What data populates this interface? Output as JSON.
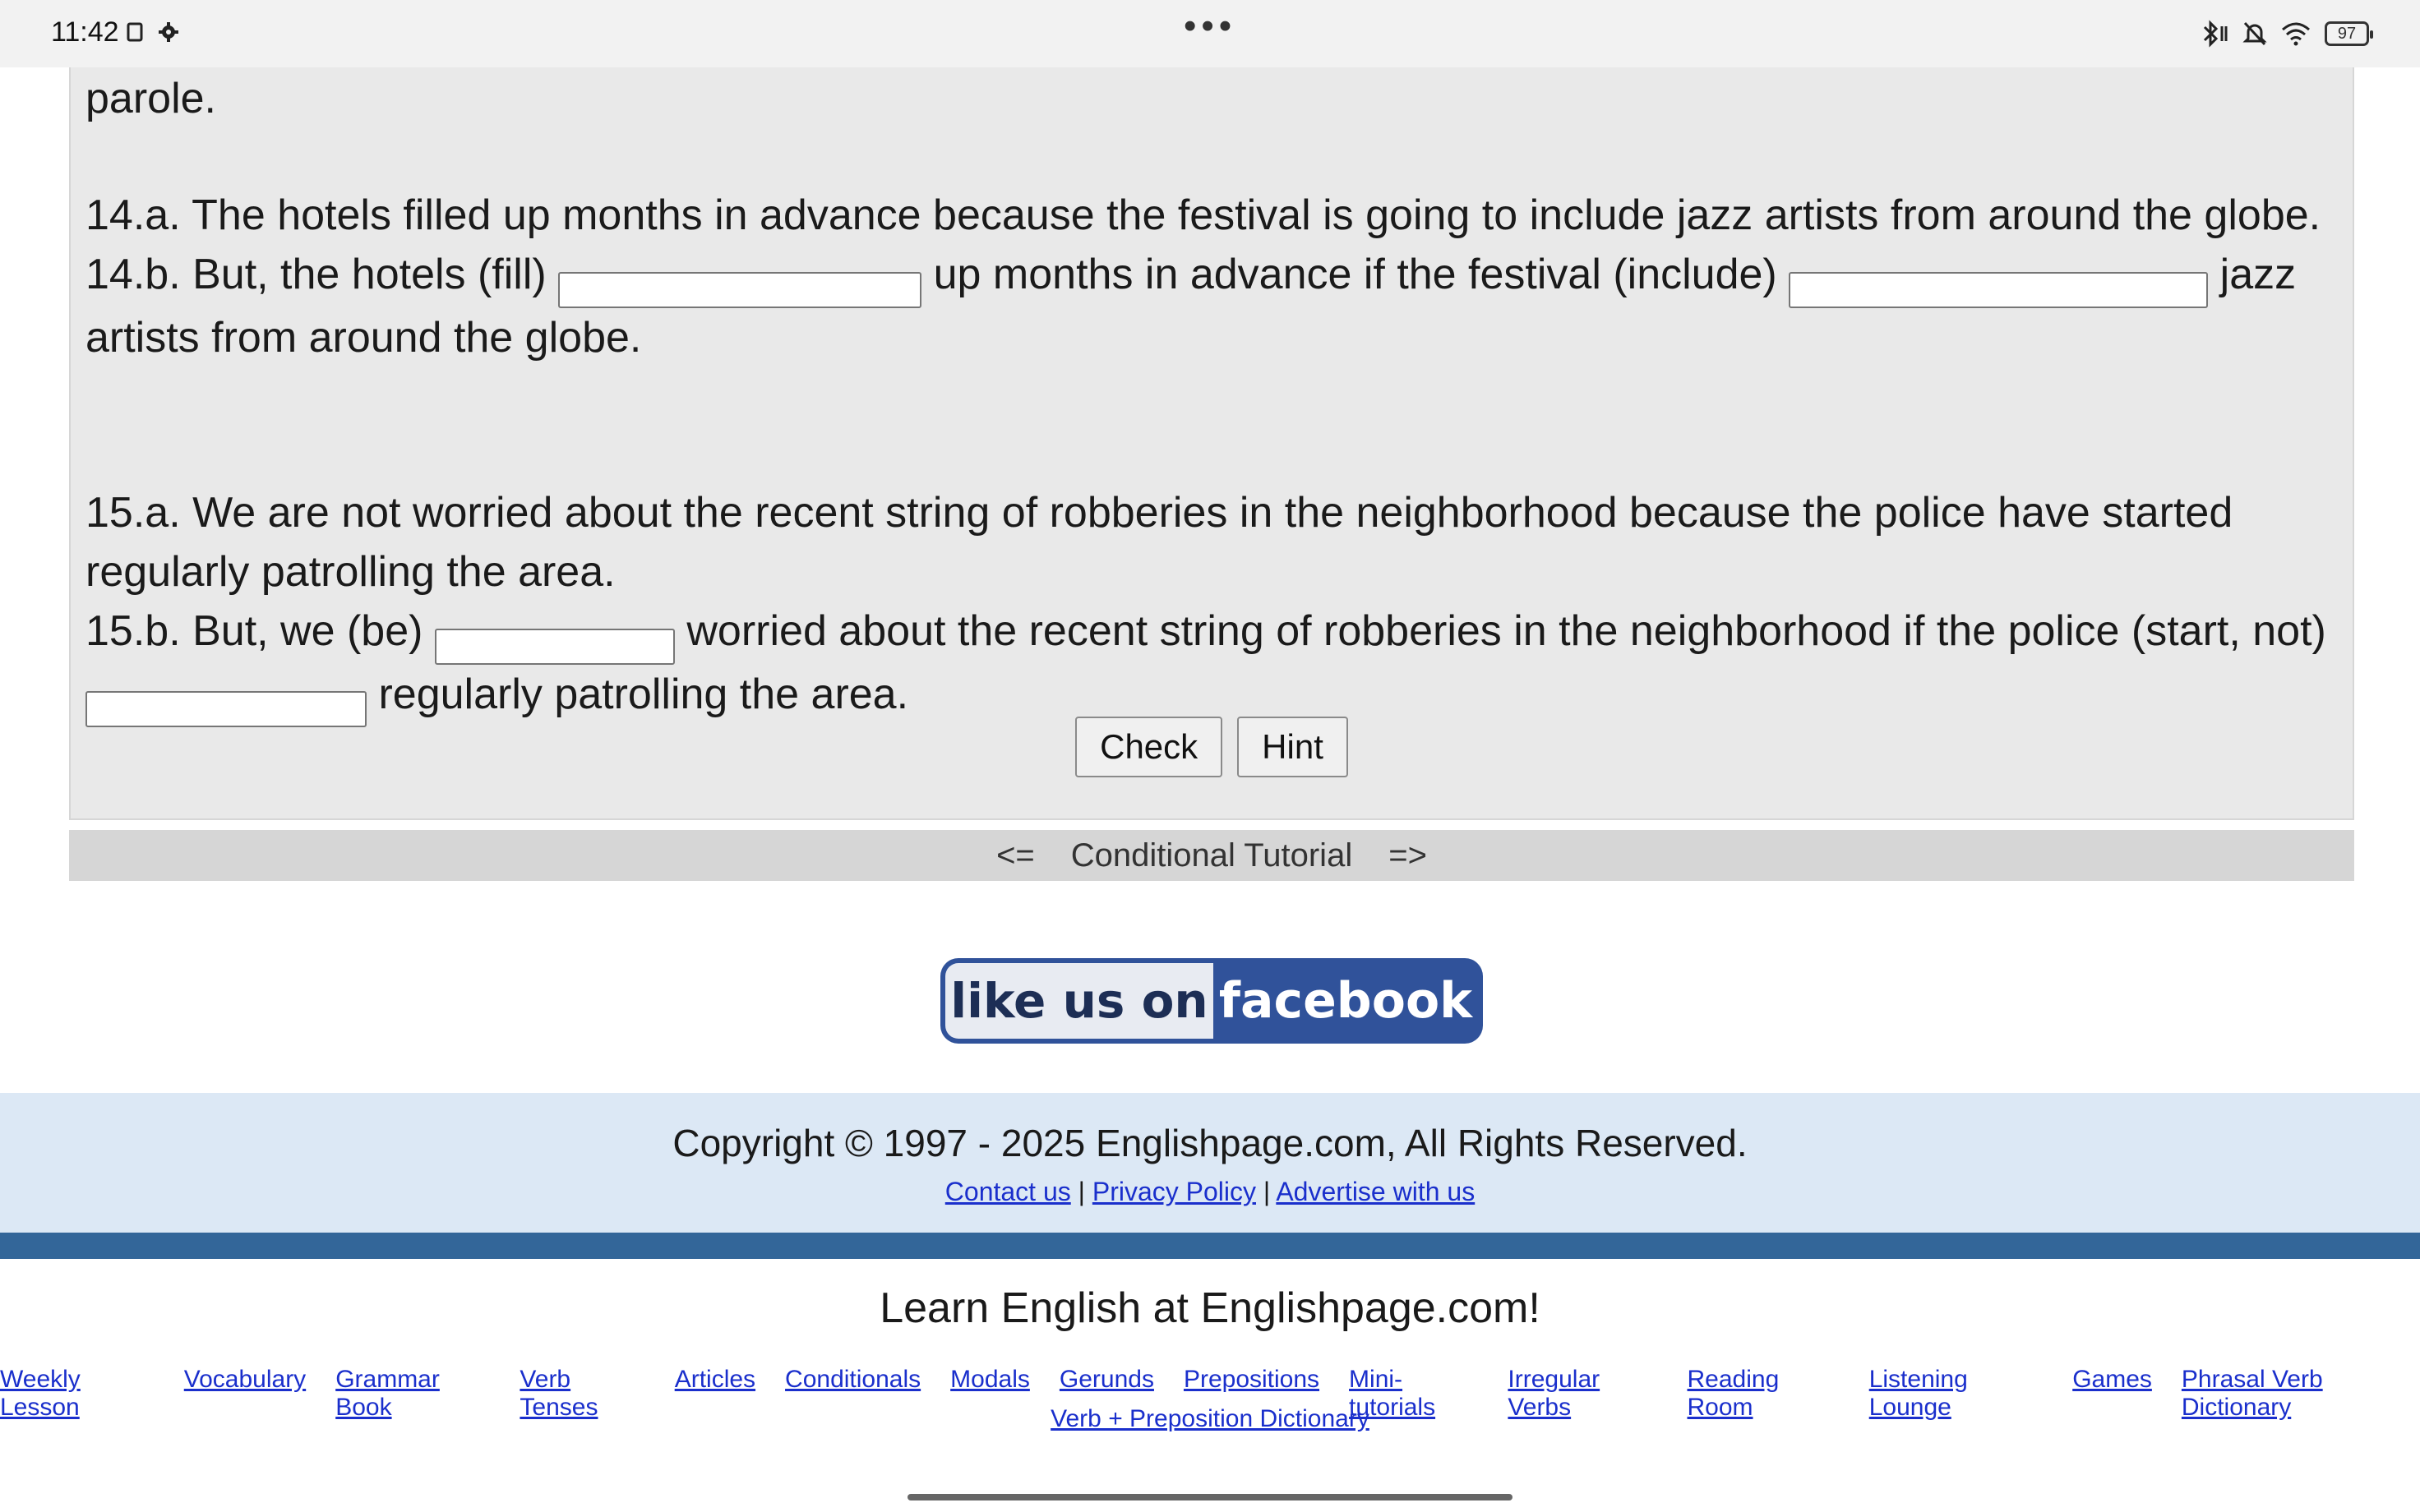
{
  "status_bar": {
    "time": "11:42",
    "left_icons": [
      "tablet-icon",
      "settings-icon"
    ],
    "right_icons": [
      "bluetooth-icon",
      "mute-icon",
      "wifi-icon",
      "battery-icon"
    ],
    "battery_level": "97",
    "menu": "•••"
  },
  "exercise": {
    "carryover": "parole.",
    "q14a": "14.a. The hotels filled up months in advance because the festival is going to include jazz artists from around the globe.",
    "q14b": {
      "part1": "14.b. But, the hotels (fill)",
      "part2": "up months in advance if the festival (include)",
      "part3": "jazz",
      "part4": "artists from around the globe.",
      "blank1_value": "",
      "blank2_value": ""
    },
    "q15a_line1": "15.a. We are not worried about the recent string of robberies in the neighborhood because the police have started",
    "q15a_line2": "regularly patrolling the area.",
    "q15b": {
      "part1": "15.b. But, we (be)",
      "part2": "worried about the recent string of robberies in the neighborhood if the police (start, not)",
      "part3": "regularly patrolling the area.",
      "blank1_value": "",
      "blank2_value": ""
    },
    "check_label": "Check",
    "hint_label": "Hint"
  },
  "tutorial_nav": {
    "prev": "<=",
    "title": "Conditional Tutorial",
    "next": "=>"
  },
  "facebook_badge": {
    "like_text": "like us on",
    "brand_text": "facebook"
  },
  "copyright": {
    "text": "Copyright © 1997 - 2025 Englishpage.com, All Rights Reserved.",
    "links": [
      "Contact us",
      "Privacy Policy",
      "Advertise with us"
    ],
    "separator": "|"
  },
  "footer": {
    "title": "Learn English at Englishpage.com!",
    "links": [
      "Weekly Lesson",
      "Vocabulary",
      "Grammar Book",
      "Verb Tenses",
      "Articles",
      "Conditionals",
      "Modals",
      "Gerunds",
      "Prepositions",
      "Mini-tutorials",
      "Irregular Verbs",
      "Reading Room",
      "Listening Lounge",
      "Games",
      "Phrasal Verb Dictionary"
    ],
    "links_row2": [
      "Verb + Preposition Dictionary"
    ]
  },
  "colors": {
    "exercise_bg": "#e9e9e9",
    "nav_bg": "#d6d6d6",
    "copyright_bg": "#dce8f5",
    "stripe": "#336699",
    "link": "#1a2fcc",
    "facebook_blue": "#30529a"
  }
}
